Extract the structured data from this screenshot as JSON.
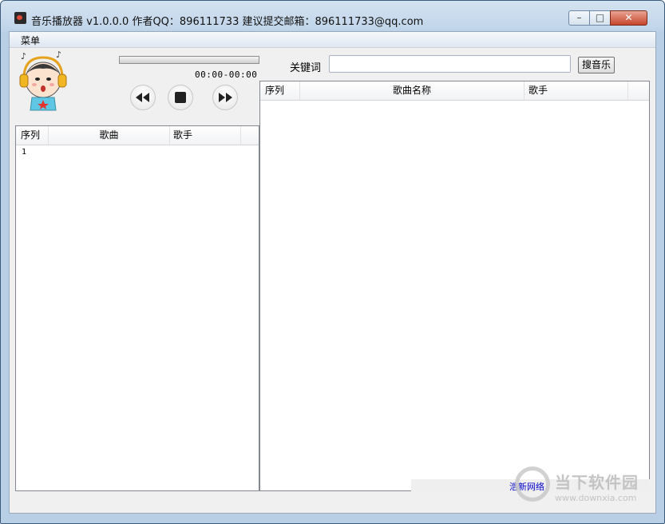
{
  "window": {
    "title": "音乐播放器 v1.0.0.0   作者QQ：896111733 建议提交邮箱：896111733@qq.com",
    "minimize_glyph": "–",
    "maximize_glyph": "□",
    "close_glyph": "✕"
  },
  "menubar": {
    "menu_label": "菜单"
  },
  "player": {
    "time": "00:00-00:00",
    "progress": 0
  },
  "search": {
    "keyword_label": "关键词",
    "input_value": "",
    "button_label": "搜音乐"
  },
  "playlist": {
    "columns": [
      "序列",
      "歌曲",
      "歌手"
    ],
    "rows": [
      {
        "index": "1",
        "song": "",
        "artist": ""
      }
    ]
  },
  "results": {
    "columns": [
      "序列",
      "歌曲名称",
      "歌手"
    ],
    "rows": []
  },
  "status": {
    "text": "浩新网络"
  },
  "watermark": {
    "brand": "当下软件园",
    "url": "www.downxia.com"
  },
  "colors": {
    "status_link": "#0000c8",
    "title_bar": "#c2d6ea",
    "close_button": "#c8452d"
  }
}
